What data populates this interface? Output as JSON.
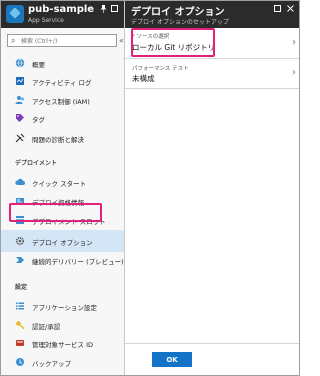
{
  "left_blade": {
    "title": "pub-sample",
    "subtitle": "App Service",
    "search_placeholder": "検索 (Ctrl+/)",
    "items": [
      {
        "label": "概要",
        "icon": "globe-icon"
      },
      {
        "label": "アクティビティ ログ",
        "icon": "activity-log-icon"
      },
      {
        "label": "アクセス制御 (IAM)",
        "icon": "access-control-icon"
      },
      {
        "label": "タグ",
        "icon": "tag-icon"
      },
      {
        "label": "問題の診断と解決",
        "icon": "wrench-icon"
      }
    ],
    "deploy_section": "デプロイメント",
    "deploy_items": [
      {
        "label": "クイック スタート",
        "icon": "cloud-icon"
      },
      {
        "label": "デプロイ資格情報",
        "icon": "credentials-icon"
      },
      {
        "label": "デプロイメント スロット",
        "icon": "slots-icon"
      },
      {
        "label": "デプロイ オプション",
        "icon": "gear-icon",
        "selected": true
      },
      {
        "label": "継続的デリバリー (プレビュー)",
        "icon": "delivery-icon"
      }
    ],
    "settings_section": "設定",
    "settings_items": [
      {
        "label": "アプリケーション設定",
        "icon": "list-icon"
      },
      {
        "label": "認証/承認",
        "icon": "key-icon"
      },
      {
        "label": "管理対象サービス ID",
        "icon": "managed-id-icon"
      },
      {
        "label": "バックアップ",
        "icon": "backup-icon"
      }
    ]
  },
  "right_blade": {
    "title": "デプロイ オプション",
    "subtitle": "デプロイ オプションのセットアップ",
    "source_label": "ソースの選択",
    "source_value": "ローカル Git リポジトリ",
    "perf_label": "パフォーマンス テスト",
    "perf_value": "未構成",
    "ok_label": "OK"
  },
  "colors": {
    "header": "#2b2b2b",
    "highlight": "#e3207a",
    "accent": "#1473c7",
    "selected": "#d4e6f6"
  }
}
